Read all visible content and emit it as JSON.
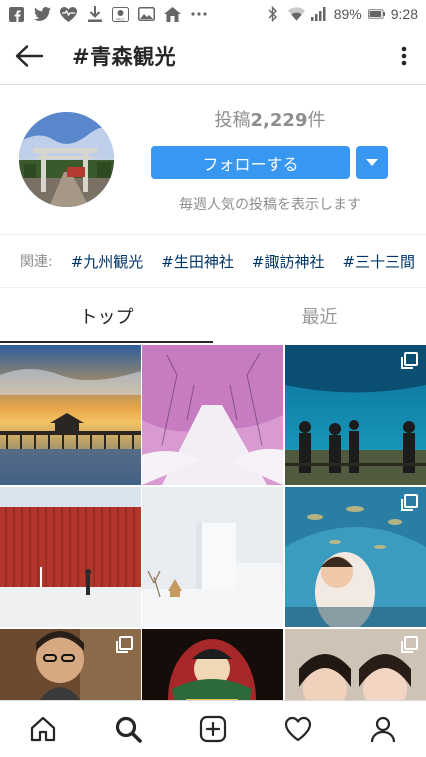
{
  "status_bar": {
    "battery_percent": "89%",
    "time": "9:28",
    "icons_left": [
      "facebook-icon",
      "twitter-icon",
      "heart-pulse-icon",
      "download-icon",
      "rec-icon",
      "image-icon",
      "home-update-icon",
      "more-dots-icon"
    ],
    "icons_right": [
      "bluetooth-icon",
      "wifi-icon",
      "signal-icon",
      "battery-icon"
    ]
  },
  "header": {
    "title": "#青森観光"
  },
  "profile": {
    "posts_prefix": "投稿",
    "posts_count": "2,229",
    "posts_suffix": "件",
    "follow_label": "フォローする",
    "subtitle": "毎週人気の投稿を表示します"
  },
  "related": {
    "label": "関連:",
    "tags": [
      "#九州観光",
      "#生田神社",
      "#諏訪神社",
      "#三十三間"
    ]
  },
  "tabs": [
    {
      "label": "トップ",
      "active": true
    },
    {
      "label": "最近",
      "active": false
    }
  ],
  "grid": {
    "posts": [
      {
        "name": "post-lake-pavilion",
        "multi": false
      },
      {
        "name": "post-cherry-snow",
        "multi": false
      },
      {
        "name": "post-aquarium-tank",
        "multi": true
      },
      {
        "name": "post-red-wall",
        "multi": false
      },
      {
        "name": "post-white-building",
        "multi": false
      },
      {
        "name": "post-fish-tunnel",
        "multi": true
      },
      {
        "name": "post-man-portrait",
        "multi": true
      },
      {
        "name": "post-nebuta-float",
        "multi": false
      },
      {
        "name": "post-women-selfie",
        "multi": true
      }
    ]
  },
  "bottom_nav": {
    "items": [
      "home-icon",
      "search-icon",
      "add-post-icon",
      "activity-heart-icon",
      "profile-icon"
    ]
  },
  "colors": {
    "accent": "#3897f0",
    "tag": "#003569",
    "muted": "#8e8e8e"
  }
}
